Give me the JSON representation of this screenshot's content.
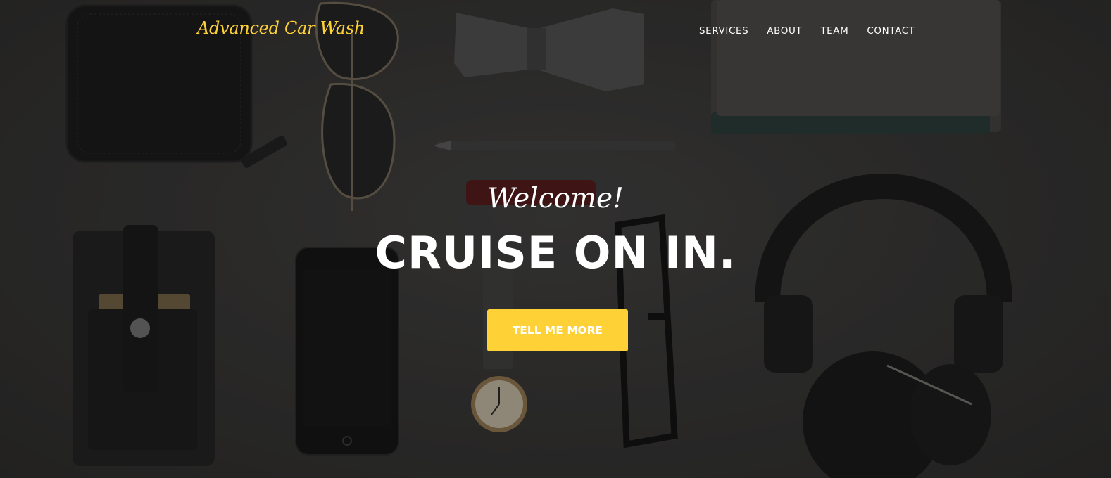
{
  "navbar": {
    "brand": "Advanced Car Wash",
    "links": [
      "SERVICES",
      "ABOUT",
      "TEAM",
      "CONTACT"
    ]
  },
  "hero": {
    "welcome": "Welcome!",
    "headline": "CRUISE ON IN.",
    "button_label": "TELL ME MORE"
  },
  "colors": {
    "accent": "#fed136",
    "text": "#ffffff",
    "overlay": "#2e2d2c"
  },
  "icons": [
    "wallet-icon",
    "sunglasses-icon",
    "bow-tie-icon",
    "notebook-icon",
    "pen-icon",
    "lighter-icon",
    "phone-case-icon",
    "smartphone-icon",
    "wristwatch-icon",
    "eyeglasses-icon",
    "headphones-icon"
  ]
}
